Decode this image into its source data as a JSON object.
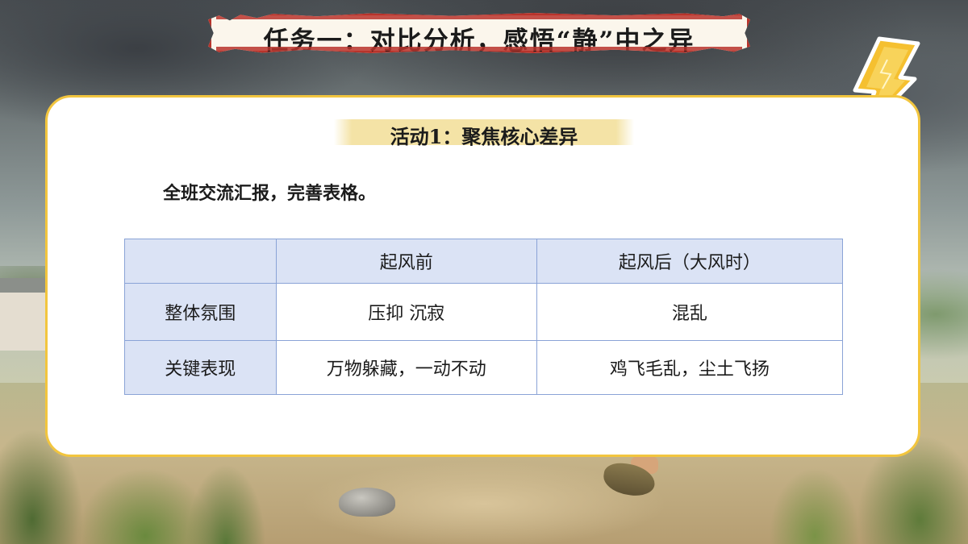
{
  "banner": {
    "title": "任务一：对比分析，感悟“静”中之异"
  },
  "activity": {
    "label": "活动1：聚焦核心差异"
  },
  "instruction": "全班交流汇报，完善表格。",
  "table": {
    "headers": [
      "",
      "起风前",
      "起风后（大风时）"
    ],
    "rows": [
      {
        "label": "整体氛围",
        "before": "压抑 沉寂",
        "after": "混乱"
      },
      {
        "label": "关键表现",
        "before": "万物躲藏，一动不动",
        "after": "鸡飞毛乱，尘土飞扬"
      }
    ]
  },
  "colors": {
    "card_border": "#f2c53e",
    "banner_border": "#b8332b",
    "table_header_bg": "#dbe3f5",
    "table_border": "#8aa3d6",
    "activity_bg": "#f4e3a6"
  },
  "icons": {
    "lightning": "lightning-icon"
  }
}
